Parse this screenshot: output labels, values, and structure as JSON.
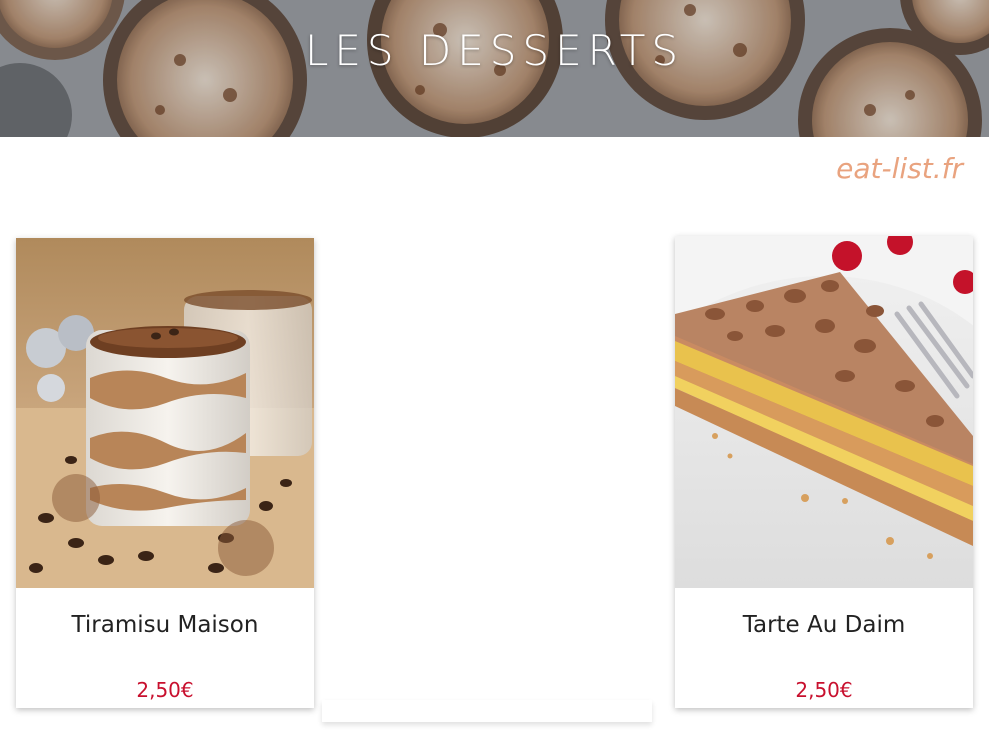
{
  "header": {
    "title": "LES DESSERTS",
    "site": "eat-list.fr"
  },
  "menu": {
    "items": [
      {
        "name": "Tiramisu Maison",
        "price": "2,50€",
        "image": "tiramisu-photo"
      },
      {
        "name": "Tarte Au Daim",
        "price": "2,50€",
        "image": "tarte-au-daim-photo"
      }
    ]
  },
  "colors": {
    "price": "#c8102e",
    "site_name": "#e9a37f",
    "title": "#ffffff"
  }
}
